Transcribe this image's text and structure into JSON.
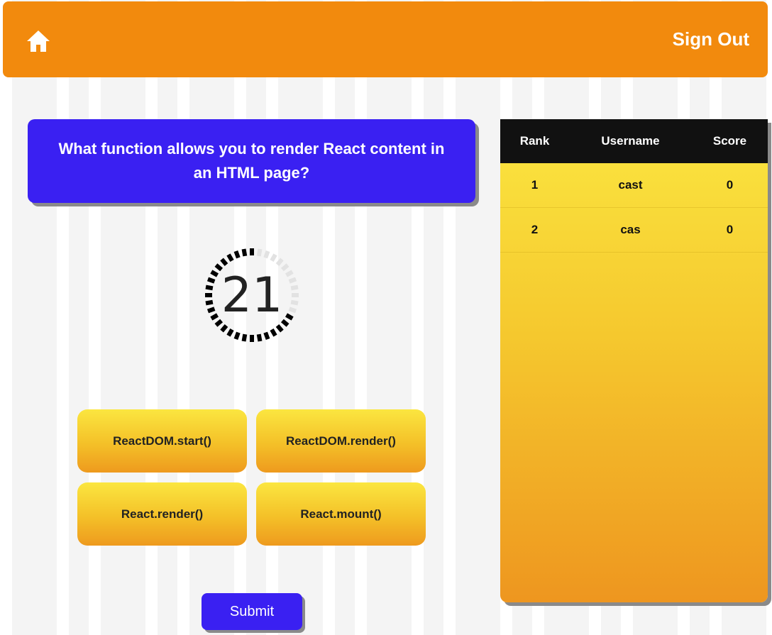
{
  "header": {
    "home_icon": "home-icon",
    "signout_label": "Sign Out"
  },
  "question": {
    "text": "What function allows you to render React content in an HTML page?"
  },
  "timer": {
    "value": "21",
    "remaining_fraction": 0.7
  },
  "answers": [
    {
      "label": "ReactDOM.start()"
    },
    {
      "label": "ReactDOM.render()"
    },
    {
      "label": "React.render()"
    },
    {
      "label": "React.mount()"
    }
  ],
  "submit_label": "Submit",
  "leaderboard": {
    "headers": {
      "rank": "Rank",
      "username": "Username",
      "score": "Score"
    },
    "rows": [
      {
        "rank": "1",
        "username": "cast",
        "score": "0"
      },
      {
        "rank": "2",
        "username": "cas",
        "score": "0"
      }
    ]
  },
  "colors": {
    "header_bg": "#f28a0d",
    "question_bg": "#3a20f2",
    "answer_gradient_top": "#fbe640",
    "answer_gradient_bottom": "#ee9a1e",
    "leaderboard_head_bg": "#111111"
  }
}
